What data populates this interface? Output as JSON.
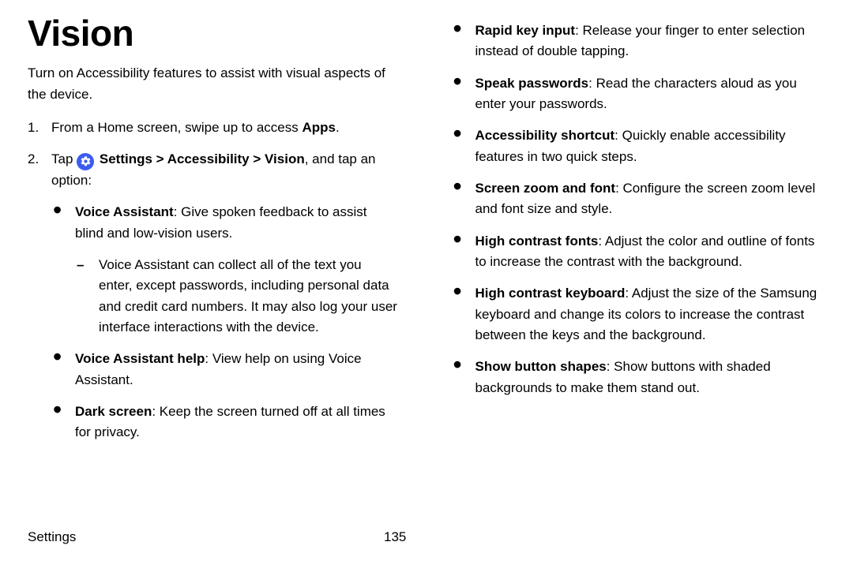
{
  "title": "Vision",
  "intro": "Turn on Accessibility features to assist with visual aspects of the device.",
  "step1": {
    "num": "1.",
    "pre": "From a Home screen, swipe up to access ",
    "apps": "Apps",
    "post": "."
  },
  "step2": {
    "num": "2.",
    "tap": "Tap ",
    "settings": "Settings",
    "sep": " > ",
    "accessibility": "Accessibility",
    "vision": "Vision",
    "tail": ", and tap an option:"
  },
  "left": {
    "voice_assistant": {
      "label": "Voice Assistant",
      "desc": ": Give spoken feedback to assist blind and low-vision users."
    },
    "voice_assistant_note": "Voice Assistant can collect all of the text you enter, except passwords, including personal data and credit card numbers. It may also log your user interface interactions with the device.",
    "voice_assistant_help": {
      "label": "Voice Assistant help",
      "desc": ": View help on using Voice Assistant."
    },
    "dark_screen": {
      "label": "Dark screen",
      "desc": ": Keep the screen turned off at all times for privacy."
    }
  },
  "right": {
    "rapid_key": {
      "label": "Rapid key input",
      "desc": ": Release your finger to enter selection instead of double tapping."
    },
    "speak_passwords": {
      "label": "Speak passwords",
      "desc": ": Read the characters aloud as you enter your passwords."
    },
    "accessibility_shortcut": {
      "label": "Accessibility shortcut",
      "desc": ": Quickly enable accessibility features in two quick steps."
    },
    "screen_zoom": {
      "label": "Screen zoom and font",
      "desc": ": Configure the screen zoom level and font size and style."
    },
    "high_contrast_fonts": {
      "label": "High contrast fonts",
      "desc": ": Adjust the color and outline of fonts to increase the contrast with the background."
    },
    "high_contrast_keyboard": {
      "label": "High contrast keyboard",
      "desc": ": Adjust the size of the Samsung keyboard and change its colors to increase the contrast between the keys and the background."
    },
    "show_button_shapes": {
      "label": "Show button shapes",
      "desc": ": Show buttons with shaded backgrounds to make them stand out."
    }
  },
  "footer": {
    "section": "Settings",
    "page": "135"
  }
}
